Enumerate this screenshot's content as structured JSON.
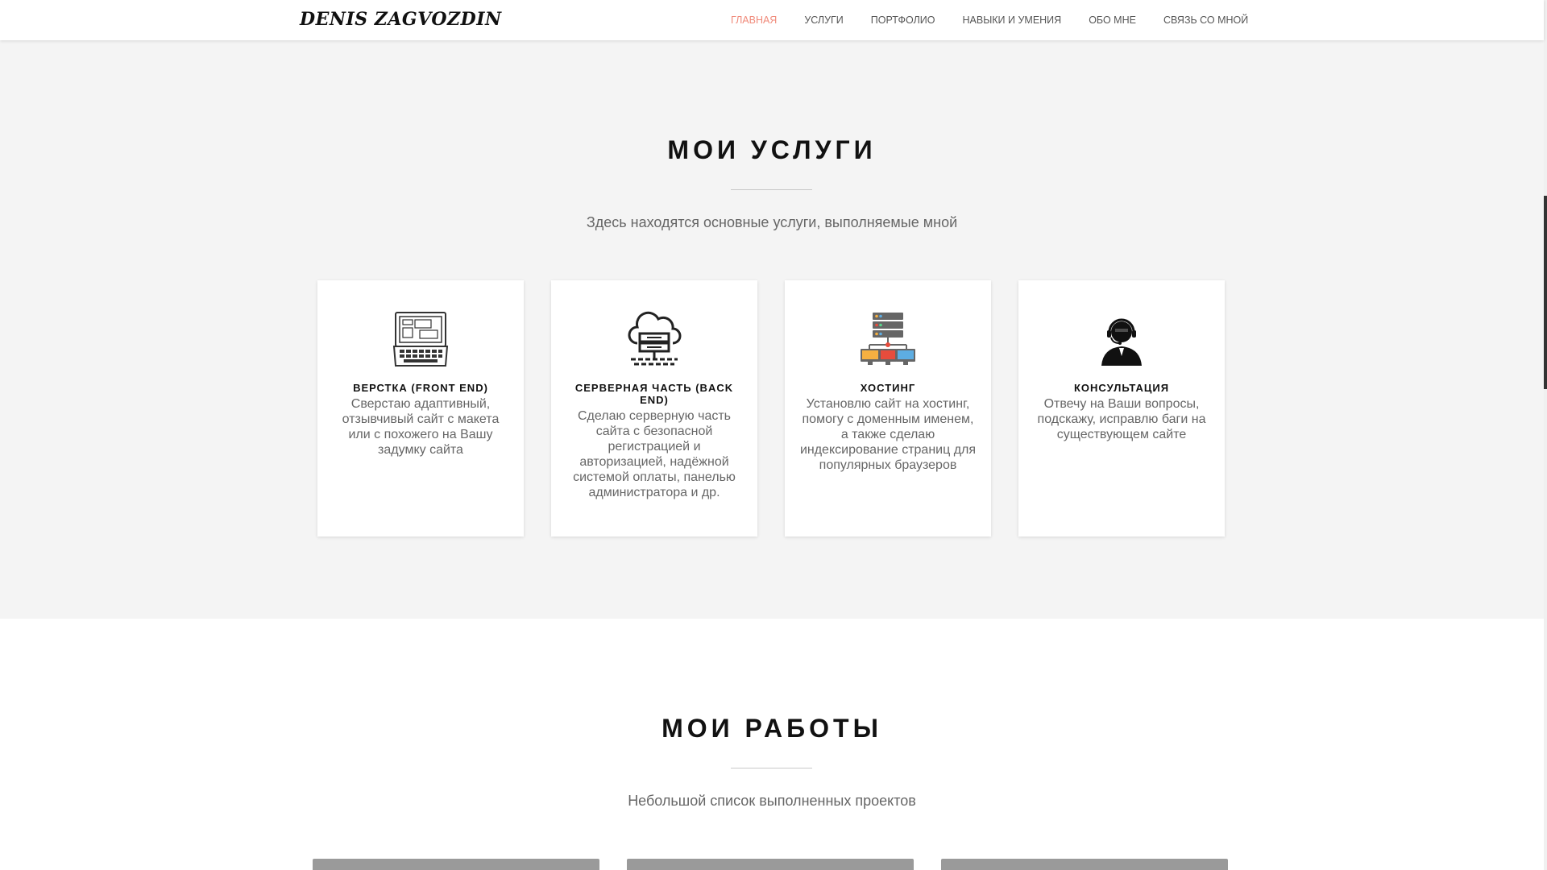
{
  "brand": "DENIS ZAGVOZDIN",
  "nav": [
    {
      "label": "ГЛАВНАЯ",
      "active": true
    },
    {
      "label": "УСЛУГИ"
    },
    {
      "label": "ПОРТФОЛИО"
    },
    {
      "label": "НАВЫКИ И УМЕНИЯ"
    },
    {
      "label": "ОБО МНЕ"
    },
    {
      "label": "СВЯЗЬ СО МНОЙ"
    }
  ],
  "services": {
    "title": "МОИ УСЛУГИ",
    "subtitle": "Здесь находятся основные услуги, выполняемые мной",
    "cards": [
      {
        "icon": "laptop-layout-icon",
        "title": "ВЕРСТКА (FRONT END)",
        "text": "Сверстаю адаптивный, отзывчивый сайт с макета или с похожего на Вашу задумку сайта"
      },
      {
        "icon": "cloud-server-icon",
        "title": "СЕРВЕРНАЯ ЧАСТЬ (BACK END)",
        "text": "Сделаю серверную часть сайта с безопасной регистрацией и авторизацией, надёжной системой оплаты, панелью администратора и др."
      },
      {
        "icon": "hosting-network-icon",
        "title": "ХОСТИНГ",
        "text": "Установлю сайт на хостинг, помогу с доменным именем, а также сделаю индексирование страниц для популярных браузеров"
      },
      {
        "icon": "support-operator-icon",
        "title": "КОНСУЛЬТАЦИЯ",
        "text": "Отвечу на Ваши вопросы, подскажу, исправлю баги на существующем сайте"
      }
    ]
  },
  "works": {
    "title": "МОИ РАБОТЫ",
    "subtitle": "Небольшой список выполненных проектов"
  },
  "colors": {
    "accent": "#f08a7a",
    "section_bg": "#f4f4f4"
  }
}
